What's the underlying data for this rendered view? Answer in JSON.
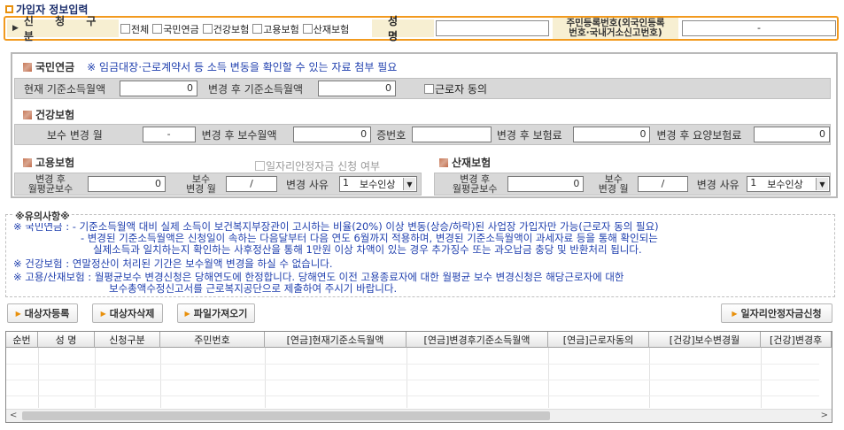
{
  "title": "가입자 정보입력",
  "apply": {
    "label": "신 청 구 분",
    "options": [
      "전체",
      "국민연금",
      "건강보험",
      "고용보험",
      "산재보험"
    ]
  },
  "name": {
    "label": "성 명",
    "value": ""
  },
  "rrn": {
    "label_line1": "주민등록번호(외국인등록",
    "label_line2": "번호·국내거소신고번호)",
    "value": "-"
  },
  "pension": {
    "title": "국민연금",
    "note": "※ 임금대장·근로계약서 등 소득 변동을 확인할 수 있는 자료 첨부 필요",
    "current_income_label": "현재 기준소득월액",
    "current_income_value": "0",
    "new_income_label": "변경 후 기준소득월액",
    "new_income_value": "0",
    "consent_label": "근로자 동의"
  },
  "health": {
    "title": "건강보험",
    "change_month_label": "보수 변경 월",
    "change_month_value": "-",
    "new_wage_label": "변경 후 보수월액",
    "new_wage_value": "0",
    "cert_label": "증번호",
    "cert_value": "",
    "new_premium_label": "변경 후 보험료",
    "new_premium_value": "0",
    "new_care_label": "변경 후 요양보험료",
    "new_care_value": "0"
  },
  "employment": {
    "title": "고용보험",
    "job_security_label": "일자리안정자금 신청 여부",
    "avg_label_1": "변경 후",
    "avg_label_2": "월평균보수",
    "avg_value": "0",
    "month_label_1": "보수",
    "month_label_2": "변경 월",
    "month_value": "/",
    "reason_label": "변경 사유",
    "reason_code": "1",
    "reason_text": "보수인상"
  },
  "accident": {
    "title": "산재보험",
    "avg_label_1": "변경 후",
    "avg_label_2": "월평균보수",
    "avg_value": "0",
    "month_label_1": "보수",
    "month_label_2": "변경 월",
    "month_value": "/",
    "reason_label": "변경 사유",
    "reason_code": "1",
    "reason_text": "보수인상"
  },
  "notice": {
    "title": "※유의사항※",
    "lines": [
      "※ 국민연금 : - 기준소득월액 대비 실제 소득이 보건복지부장관이 고시하는 비율(20%) 이상 변동(상승/하락)된 사업장 가입자만 가능(근로자 동의 필요)",
      "- 변경된 기준소득월액은 신청일이 속하는 다음달부터 다음 연도 6월까지 적용하며, 변경된 기준소득월액이 과세자료 등을 통해 확인되는",
      "실제소득과 일치하는지 확인하는 사후정산을 통해 1만원 이상 차액이 있는 경우 추가징수 또는 과오납금 충당 및 반환처리 됩니다.",
      "※ 건강보험 : 연말정산이 처리된 기간은 보수월액 변경을 하실 수 없습니다.",
      "※ 고용/산재보험 : 월평균보수 변경신청은 당해연도에 한정합니다. 당해연도 이전 고용종료자에 대한 월평균 보수 변경신청은 해당근로자에 대한",
      "보수총액수정신고서를 근로복지공단으로 제출하여 주시기 바랍니다."
    ]
  },
  "buttons": {
    "add": "대상자등록",
    "delete": "대상자삭제",
    "import": "파일가져오기",
    "job_security": "일자리안정자금신청"
  },
  "grid": {
    "columns": [
      "순번",
      "성 명",
      "신청구분",
      "주민번호",
      "[연금]현재기준소득월액",
      "[연금]변경후기준소득월액",
      "[연금]근로자동의",
      "[건강]보수변경월",
      "[건강]변경후"
    ]
  }
}
